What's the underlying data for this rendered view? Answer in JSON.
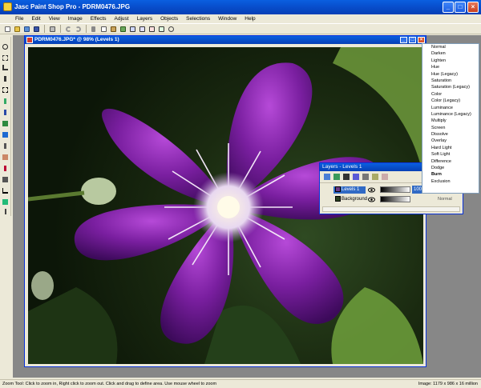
{
  "app": {
    "title": "Jasc Paint Shop Pro - PDRM0476.JPG",
    "minimize": "_",
    "maximize": "□",
    "close": "×"
  },
  "menu": [
    "File",
    "Edit",
    "View",
    "Image",
    "Effects",
    "Adjust",
    "Layers",
    "Objects",
    "Selections",
    "Window",
    "Help"
  ],
  "image_window": {
    "title": "PDRM0476.JPG* @ 98% (Levels 1)"
  },
  "blend_modes": {
    "items": [
      "Normal",
      "Darken",
      "Lighten",
      "Hue",
      "Hue (Legacy)",
      "Saturation",
      "Saturation (Legacy)",
      "Color",
      "Color (Legacy)",
      "Luminance",
      "Luminance (Legacy)",
      "Multiply",
      "Screen",
      "Dissolve",
      "Overlay",
      "Hard Light",
      "Soft Light",
      "Difference",
      "Dodge",
      "Burn",
      "Exclusion"
    ],
    "selected_index": 19
  },
  "layers_palette": {
    "title": "Layers - Levels 1",
    "layers": [
      {
        "name": "Levels 1",
        "opacity": "100",
        "mode": "",
        "active": true
      },
      {
        "name": "Background",
        "opacity": "",
        "mode": "Normal",
        "active": false
      }
    ]
  },
  "status": {
    "left": "Zoom Tool: Click to zoom in, Right click to zoom out. Click and drag to define area. Use mouse wheel to zoom",
    "right": "Image: 1179 x 986 x 16 million"
  },
  "colors": {
    "titlebar": "#0a5fe0",
    "chrome": "#ece9d8",
    "workspace": "#878787",
    "flower": "#7a1fa0"
  }
}
